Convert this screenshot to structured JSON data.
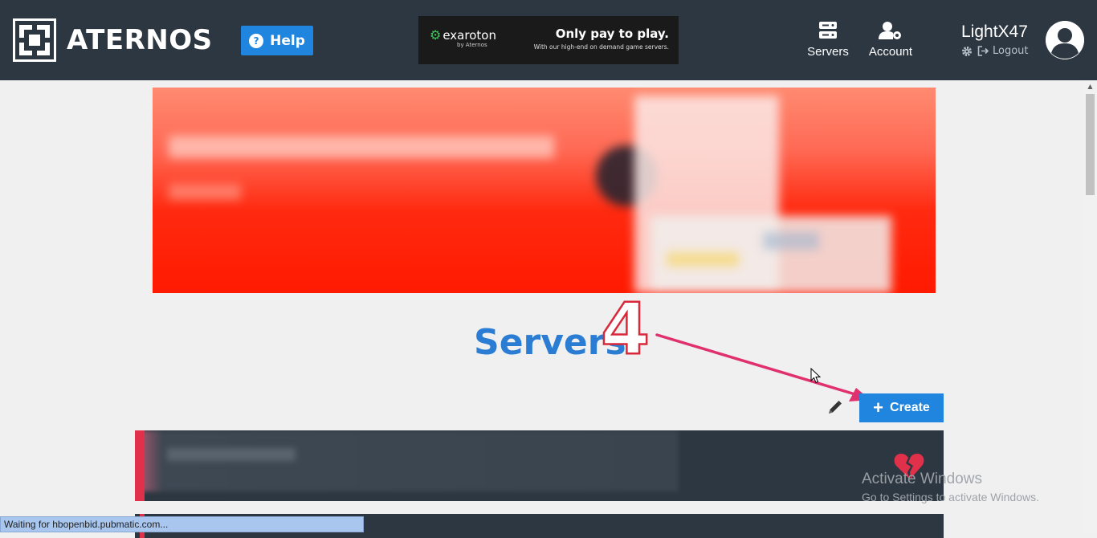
{
  "header": {
    "brand": "ATERNOS",
    "help_label": "Help",
    "ad": {
      "brand": "exaroton",
      "brand_sub": "by Aternos",
      "headline": "Only pay to play.",
      "tagline": "With our high-end on demand game servers."
    },
    "nav": {
      "servers_label": "Servers",
      "account_label": "Account"
    },
    "user": {
      "name": "LightX47",
      "logout_label": "Logout"
    }
  },
  "main": {
    "title": "Servers",
    "annotation_number": "4",
    "create_label": "Create"
  },
  "overlay": {
    "windows_title": "Activate Windows",
    "windows_sub": "Go to Settings to activate Windows."
  },
  "browser": {
    "status_text": "Waiting for hbopenbid.pubmatic.com..."
  },
  "colors": {
    "header_bg": "#2d3741",
    "accent_blue": "#1f85de",
    "title_blue": "#2a7dd3",
    "annotation_red": "#d8283a",
    "status_red": "#e0304a"
  }
}
